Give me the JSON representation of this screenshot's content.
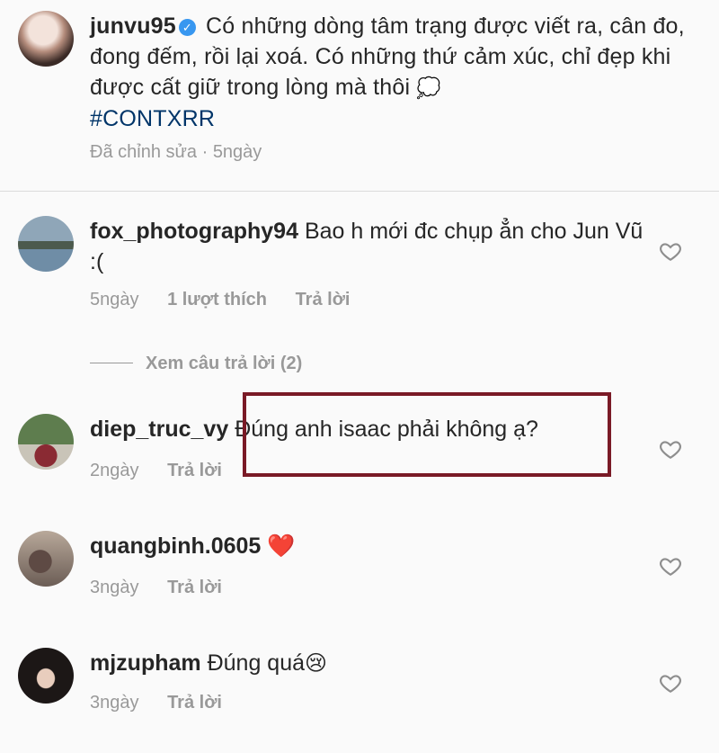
{
  "caption": {
    "username": "junvu95",
    "text": "Có những dòng tâm trạng được viết ra, cân đo, đong đếm, rồi lại xoá. Có những thứ cảm xúc, chỉ đẹp khi được cất giữ trong lòng mà thôi",
    "emoji": "💭",
    "hashtag": "#CONTXRR",
    "edited": "Đã chỉnh sửa",
    "separator": "·",
    "time": "5ngày"
  },
  "comments": [
    {
      "username": "fox_photography94",
      "text": "Bao h mới đc chụp ẳn cho Jun Vũ :(",
      "time": "5ngày",
      "likes": "1 lượt thích",
      "reply": "Trả lời"
    },
    {
      "username": "diep_truc_vy",
      "text": "Đúng anh isaac phải không ạ?",
      "time": "2ngày",
      "reply": "Trả lời"
    },
    {
      "username": "quangbinh.0605",
      "text": "",
      "emoji": "❤️",
      "time": "3ngày",
      "reply": "Trả lời"
    },
    {
      "username": "mjzupham",
      "text": "Đúng quá",
      "emoji": "😢",
      "time": "3ngày",
      "reply": "Trả lời"
    }
  ],
  "view_replies": "Xem câu trả lời (2)",
  "colors": {
    "text": "#262626",
    "muted": "#999999",
    "hashtag": "#003569",
    "verified": "#3897f0",
    "highlight_border": "#7a1a26"
  }
}
